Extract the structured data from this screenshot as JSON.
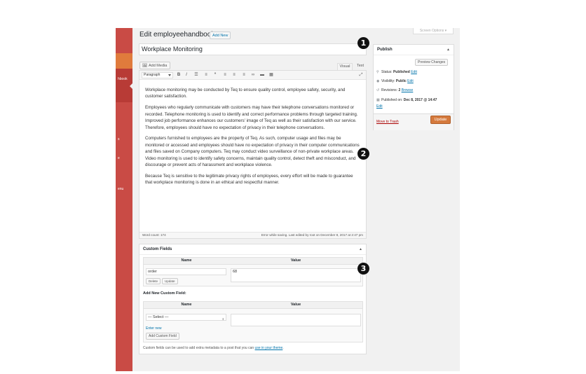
{
  "sidebar": {
    "items": [
      {
        "label": "hbook"
      },
      {
        "label": "s"
      },
      {
        "label": "e"
      },
      {
        "label": "enu"
      }
    ]
  },
  "header": {
    "title": "Edit employeehandbook",
    "add_new": "Add New",
    "screen_options": "Screen Options ▾"
  },
  "post": {
    "title": "Workplace Monitoring"
  },
  "editor": {
    "add_media": "Add Media",
    "tabs": [
      "Visual",
      "Text"
    ],
    "format": "Paragraph",
    "toolbar_icons": [
      {
        "name": "bold-icon",
        "glyph": "B"
      },
      {
        "name": "italic-icon",
        "glyph": "I"
      },
      {
        "name": "bulleted-list-icon",
        "glyph": "☰"
      },
      {
        "name": "numbered-list-icon",
        "glyph": "≡"
      },
      {
        "name": "blockquote-icon",
        "glyph": "“"
      },
      {
        "name": "align-left-icon",
        "glyph": "≡"
      },
      {
        "name": "align-center-icon",
        "glyph": "≡"
      },
      {
        "name": "align-right-icon",
        "glyph": "≡"
      },
      {
        "name": "insert-link-icon",
        "glyph": "∞"
      },
      {
        "name": "read-more-icon",
        "glyph": "▬"
      },
      {
        "name": "toolbar-toggle-icon",
        "glyph": "▦"
      }
    ],
    "fullscreen_icon": "⤢",
    "paragraphs": [
      "Workplace monitoring may be conducted by Teq to ensure quality control, employee safety, security, and customer satisfaction.",
      "Employees who regularly communicate with customers may have their telephone conversations monitored or recorded. Telephone monitoring is used to identify and correct performance problems through targeted training. Improved job performance enhances our customers' image of Teq as well as their satisfaction with our service. Therefore, employees should have no expectation of privacy in their telephone conversations.",
      "Computers furnished to employees are the property of Teq. As such, computer usage and files may be monitored or accessed and employees should have no expectation of privacy in their computer communications and files saved on Company computers. Teq may conduct video surveillance of non-private workplace areas. Video monitoring is used to identify safety concerns, maintain quality control, detect theft and misconduct, and discourage or prevent acts of harassment and workplace violence.",
      "Because Teq is sensitive to the legitimate privacy rights of employees, every effort will be made to guarantee that workplace monitoring is done in an ethical and respectful manner."
    ],
    "word_count": "Word count: 174",
    "save_status": "Error while saving. Last edited by root on December 8, 2017 at 2:47 pm"
  },
  "custom_fields": {
    "title": "Custom Fields",
    "col_name": "Name",
    "col_value": "Value",
    "existing": {
      "name": "order",
      "value": "68"
    },
    "delete": "Delete",
    "update": "Update",
    "add_new_label": "Add New Custom Field:",
    "select_placeholder": "— Select —",
    "enter_new": "Enter new",
    "add_button": "Add Custom Field",
    "note": "Custom fields can be used to add extra metadata to a post that you can ",
    "note_link": "use in your theme",
    "note_end": "."
  },
  "publish": {
    "title": "Publish",
    "preview": "Preview Changes",
    "status_label": "Status: ",
    "status_value": "Published",
    "visibility_label": "Visibility: ",
    "visibility_value": "Public",
    "revisions_label": "Revisions: ",
    "revisions_value": "2",
    "browse": "Browse",
    "published_label": "Published on: ",
    "published_value": "Dec 8, 2017 @ 14:47",
    "edit": "Edit",
    "move_trash": "Move to Trash",
    "update": "Update"
  },
  "callouts": [
    "1",
    "2",
    "3"
  ],
  "colors": {
    "sidebar": "#c94b45",
    "primary_button": "#d57a3d",
    "link": "#0073aa"
  }
}
